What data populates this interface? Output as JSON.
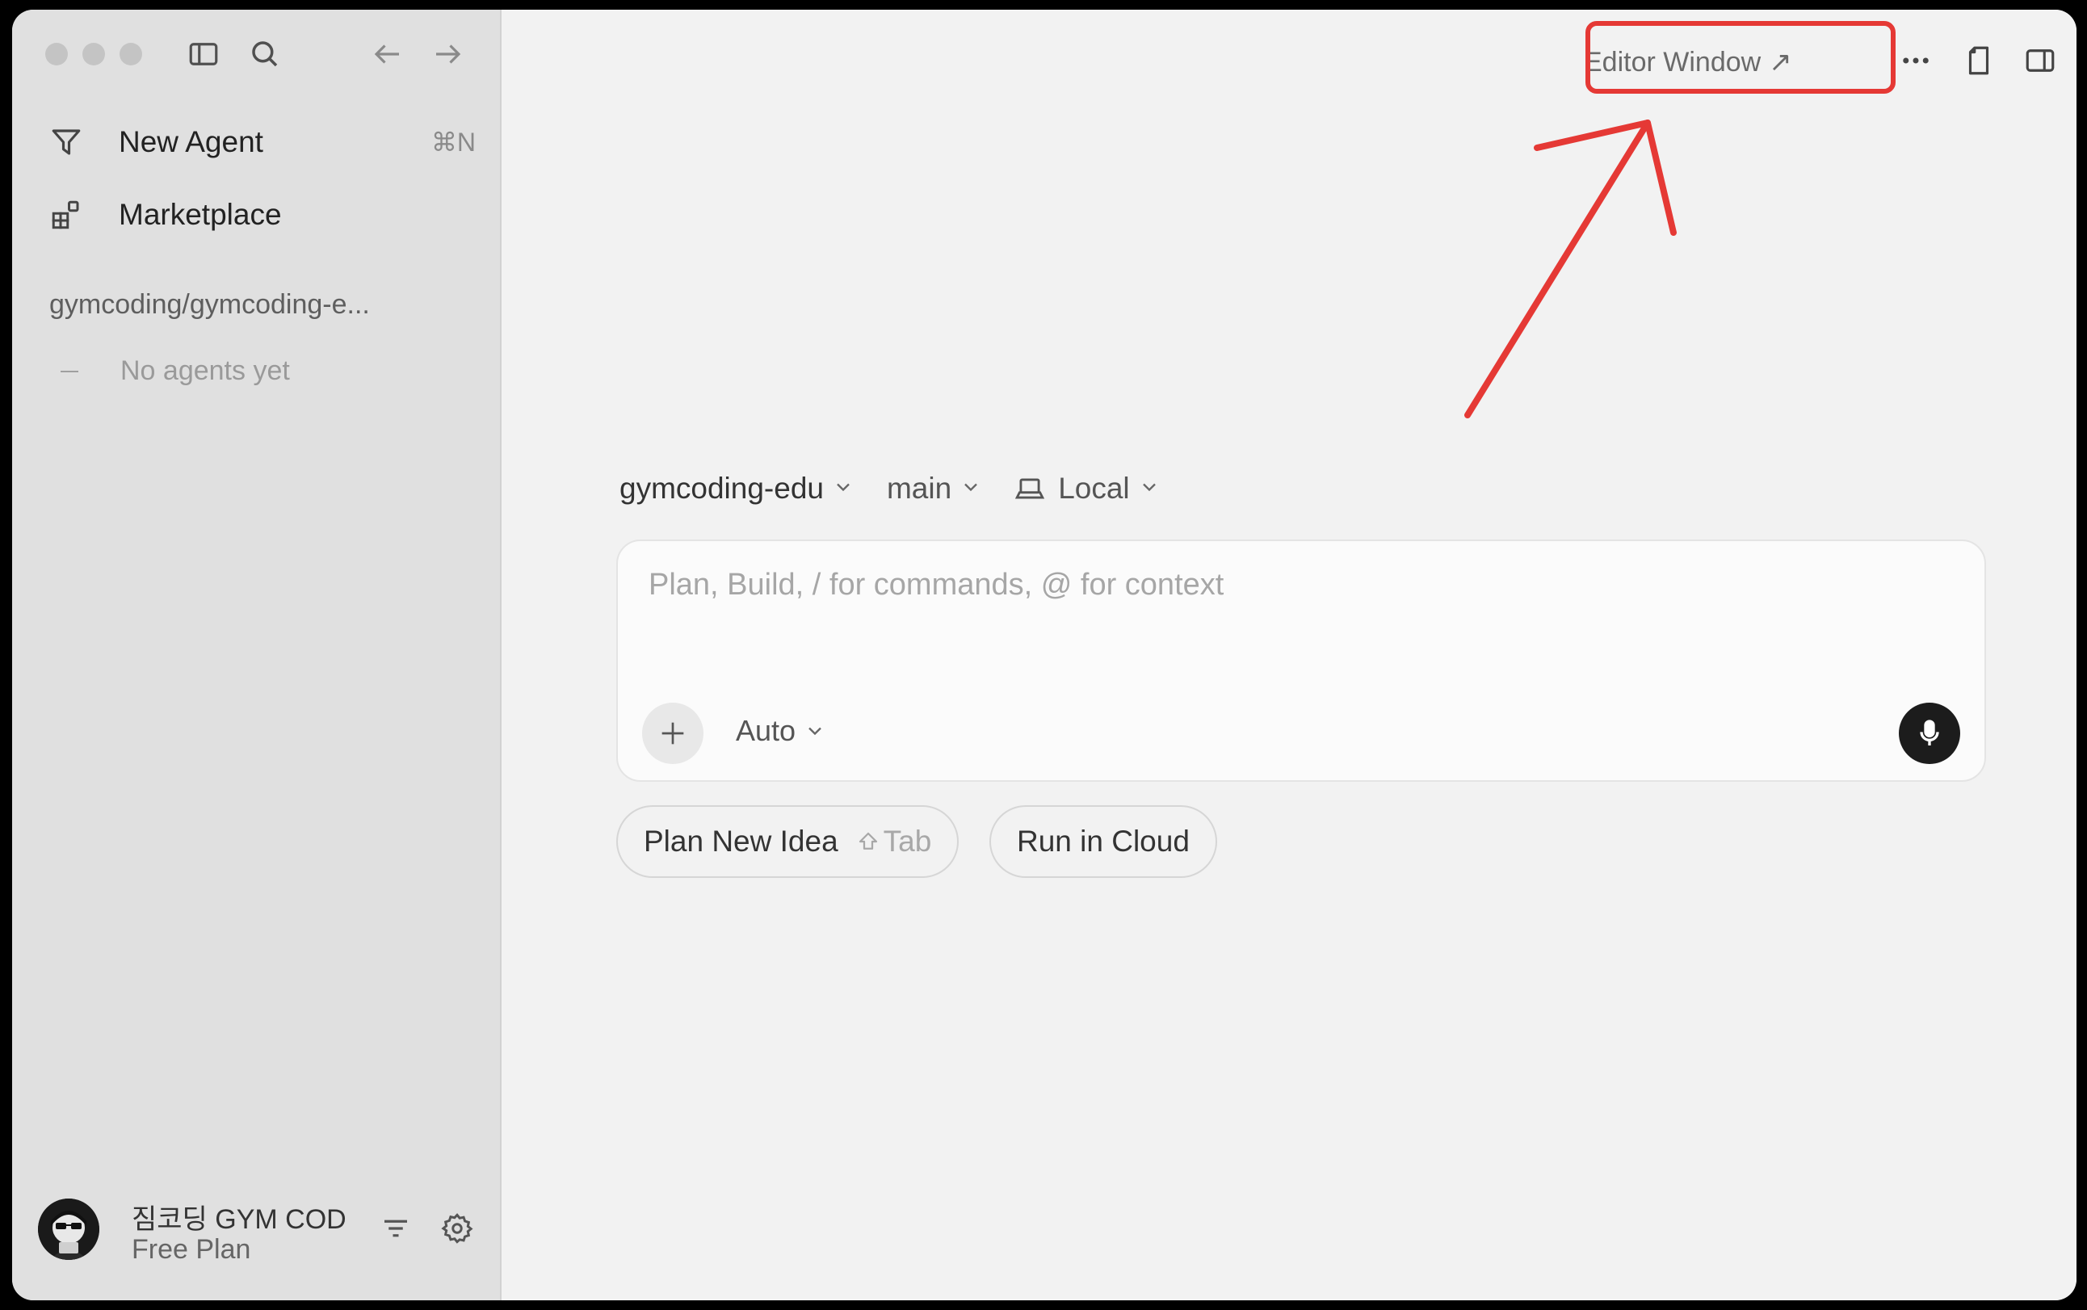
{
  "sidebar": {
    "items": [
      {
        "label": "New Agent",
        "shortcut": "⌘N",
        "icon": "new-agent-icon"
      },
      {
        "label": "Marketplace",
        "icon": "marketplace-icon"
      }
    ],
    "repo": "gymcoding/gymcoding-e...",
    "empty_state": "No agents yet",
    "user": {
      "name": "짐코딩 GYM CODING",
      "plan": "Free Plan"
    }
  },
  "header": {
    "editor_window_label": "Editor Window",
    "editor_window_icon": "↗"
  },
  "composer": {
    "repo_select": "gymcoding-edu",
    "branch_select": "main",
    "env_select": "Local",
    "placeholder": "Plan, Build, / for commands, @ for context",
    "value": "",
    "mode_select": "Auto"
  },
  "actions": {
    "plan_new_idea": "Plan New Idea",
    "plan_hint": "Tab",
    "run_in_cloud": "Run in Cloud"
  },
  "annotation": {
    "color": "#e53935"
  }
}
